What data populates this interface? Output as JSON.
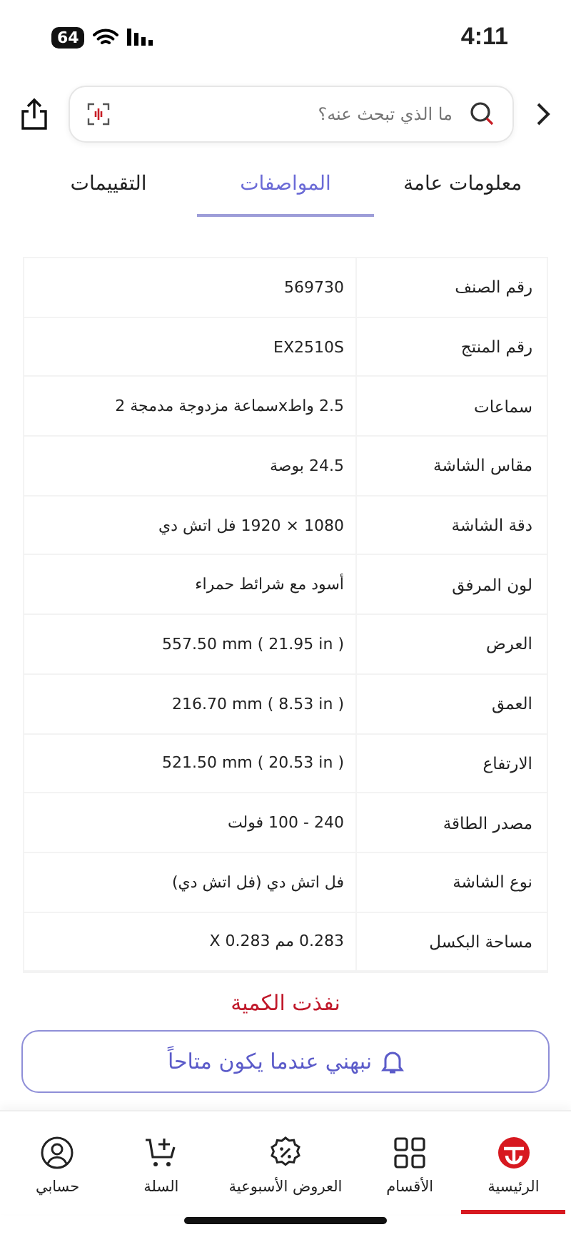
{
  "status_bar": {
    "time": "4:11",
    "battery": "64"
  },
  "search": {
    "placeholder": "ما الذي تبحث عنه؟"
  },
  "tabs": [
    {
      "label": "معلومات عامة",
      "selected": false
    },
    {
      "label": "المواصفات",
      "selected": true
    },
    {
      "label": "التقييمات",
      "selected": false
    }
  ],
  "specs": [
    {
      "label": "رقم الصنف",
      "value": "569730"
    },
    {
      "label": "رقم المنتج",
      "value": "EX2510S"
    },
    {
      "label": "سماعات",
      "value": "2.5 واطxسماعة مزدوجة مدمجة 2"
    },
    {
      "label": "مقاس الشاشة",
      "value": "24.5 بوصة"
    },
    {
      "label": "دقة الشاشة",
      "value": "1080 × 1920 فل اتش دي"
    },
    {
      "label": "لون المرفق",
      "value": "أسود مع شرائط حمراء"
    },
    {
      "label": "العرض",
      "value": "557.50 mm ( 21.95 in )"
    },
    {
      "label": "العمق",
      "value": "216.70 mm ( 8.53 in )"
    },
    {
      "label": "الارتفاع",
      "value": "521.50 mm ( 20.53 in )"
    },
    {
      "label": "مصدر الطاقة",
      "value": "240 - 100 فولت"
    },
    {
      "label": "نوع الشاشة",
      "value": "فل اتش دي (فل اتش دي)"
    },
    {
      "label": "مساحة البكسل",
      "value": "0.283 مم 0.283 X"
    }
  ],
  "stock_status": "نفذت الكمية",
  "notify_button": "نبهني عندما يكون متاحاً",
  "nav": [
    {
      "kind": "home",
      "label": "الرئيسية",
      "selected": true
    },
    {
      "kind": "categories",
      "label": "الأقسام",
      "selected": false
    },
    {
      "kind": "offers",
      "label": "العروض الأسبوعية",
      "selected": false
    },
    {
      "kind": "cart",
      "label": "السلة",
      "selected": false
    },
    {
      "kind": "account",
      "label": "حسابي",
      "selected": false
    }
  ]
}
